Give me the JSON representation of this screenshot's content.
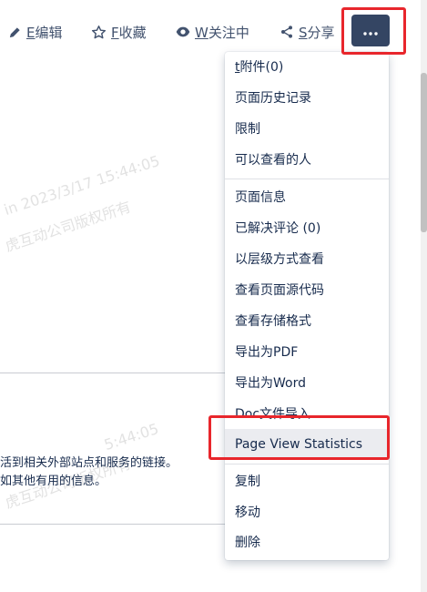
{
  "toolbar": {
    "edit": {
      "key": "E",
      "label": "编辑"
    },
    "favorite": {
      "key": "F",
      "label": "收藏"
    },
    "watch": {
      "key": "W",
      "label": "关注中"
    },
    "share": {
      "key": "S",
      "label": "分享"
    },
    "more_icon": "ellipsis-icon"
  },
  "watermarks": [
    "in 2023/3/17 15:44:05",
    "虎互动公司版权所有",
    "5:44:05",
    "虎互动公司版权所有"
  ],
  "content": {
    "line1": "活到相关外部站点和服务的链接。",
    "line2": "如其他有用的信息。"
  },
  "menu": {
    "group1": [
      {
        "key": "t",
        "label": "附件(0)"
      },
      {
        "label": "页面历史记录"
      },
      {
        "label": "限制"
      },
      {
        "label": "可以查看的人"
      }
    ],
    "group2": [
      {
        "label": "页面信息"
      },
      {
        "label": "已解决评论 (0)"
      },
      {
        "label": "以层级方式查看"
      },
      {
        "label": "查看页面源代码"
      },
      {
        "label": "查看存储格式"
      },
      {
        "label": "导出为PDF"
      },
      {
        "label": "导出为Word"
      },
      {
        "label": "Doc文件导入"
      },
      {
        "label": "Page View Statistics"
      }
    ],
    "group3": [
      {
        "label": "复制"
      },
      {
        "label": "移动"
      },
      {
        "label": "删除"
      }
    ]
  },
  "colors": {
    "highlight_box": "#e8262c",
    "more_button": "#344563",
    "menu_active": "#ebecf0"
  }
}
